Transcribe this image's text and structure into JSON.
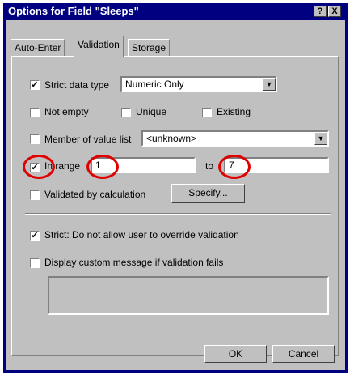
{
  "window": {
    "title": "Options for Field \"Sleeps\"",
    "help_button": "?",
    "close_button": "X"
  },
  "tabs": [
    {
      "label": "Auto-Enter"
    },
    {
      "label": "Validation"
    },
    {
      "label": "Storage"
    }
  ],
  "validation": {
    "strict_data_type": {
      "label": "Strict data type",
      "checked": true,
      "value": "Numeric Only"
    },
    "not_empty": {
      "label": "Not empty",
      "checked": false
    },
    "unique": {
      "label": "Unique",
      "checked": false
    },
    "existing": {
      "label": "Existing",
      "checked": false
    },
    "member_of_value_list": {
      "label": "Member of value list",
      "checked": false,
      "value": "<unknown>"
    },
    "in_range": {
      "label": "In range",
      "checked": true,
      "from": "1",
      "to_label": "to",
      "to": "7"
    },
    "validated_by_calculation": {
      "label": "Validated by calculation",
      "checked": false,
      "button": "Specify..."
    },
    "strict_override": {
      "label": "Strict: Do not allow user to override validation",
      "checked": true
    },
    "display_custom_message": {
      "label": "Display custom message if validation fails",
      "checked": false,
      "message": ""
    }
  },
  "buttons": {
    "ok": "OK",
    "cancel": "Cancel"
  },
  "highlight_color": "#e00000"
}
